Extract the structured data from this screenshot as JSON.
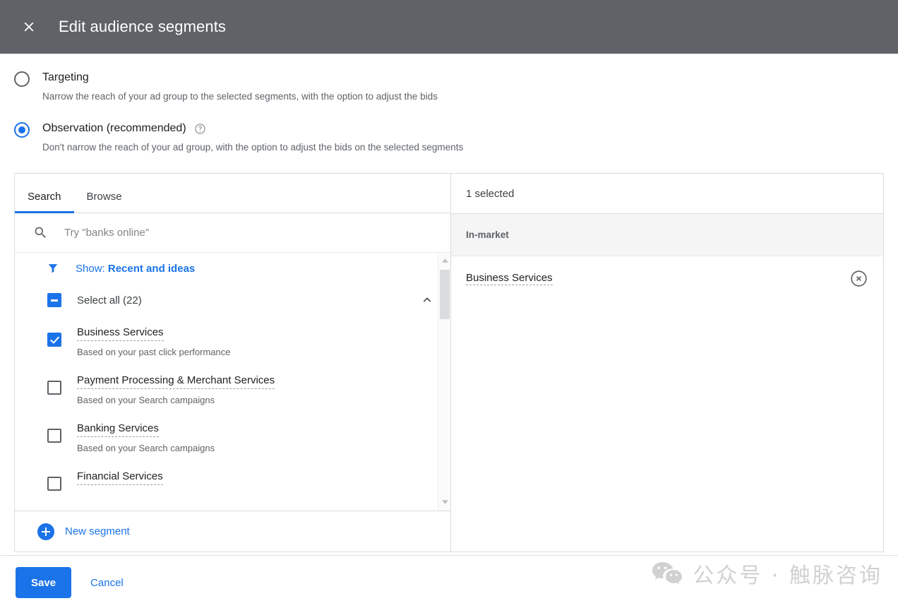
{
  "header": {
    "title": "Edit audience segments",
    "close_icon": "close-icon"
  },
  "targeting_options": [
    {
      "label": "Targeting",
      "description": "Narrow the reach of your ad group to the selected segments, with the option to adjust the bids",
      "selected": false,
      "help": false
    },
    {
      "label": "Observation (recommended)",
      "description": "Don't narrow the reach of your ad group, with the option to adjust the bids on the selected segments",
      "selected": true,
      "help": true
    }
  ],
  "left_pane": {
    "tabs": [
      {
        "label": "Search",
        "active": true
      },
      {
        "label": "Browse",
        "active": false
      }
    ],
    "search": {
      "placeholder": "Try \"banks online\"",
      "value": "",
      "icon": "search-icon"
    },
    "filter": {
      "icon": "filter-icon",
      "prefix": "Show:",
      "value": "Recent and ideas"
    },
    "select_all": {
      "label": "Select all (22)",
      "state": "indeterminate",
      "collapse_icon": "chevron-up-icon"
    },
    "segments": [
      {
        "name": "Business Services",
        "subtitle": "Based on your past click performance",
        "checked": true
      },
      {
        "name": "Payment Processing & Merchant Services",
        "subtitle": "Based on your Search campaigns",
        "checked": false
      },
      {
        "name": "Banking Services",
        "subtitle": "Based on your Search campaigns",
        "checked": false
      },
      {
        "name": "Financial Services",
        "subtitle": "",
        "checked": false
      }
    ],
    "new_segment_label": "New segment"
  },
  "right_pane": {
    "selected_count_label": "1 selected",
    "group_label": "In-market",
    "selected_items": [
      {
        "name": "Business Services",
        "remove_icon": "remove-circle-icon"
      }
    ]
  },
  "footer": {
    "save_label": "Save",
    "cancel_label": "Cancel"
  },
  "watermark": {
    "icon": "wechat-icon",
    "text": "公众号 · 触脉咨询"
  },
  "colors": {
    "header_bg": "#5f6368",
    "accent": "#1a73e8",
    "border": "#dadce0",
    "group_bg": "#f5f5f5",
    "muted_text": "#5f6368"
  }
}
